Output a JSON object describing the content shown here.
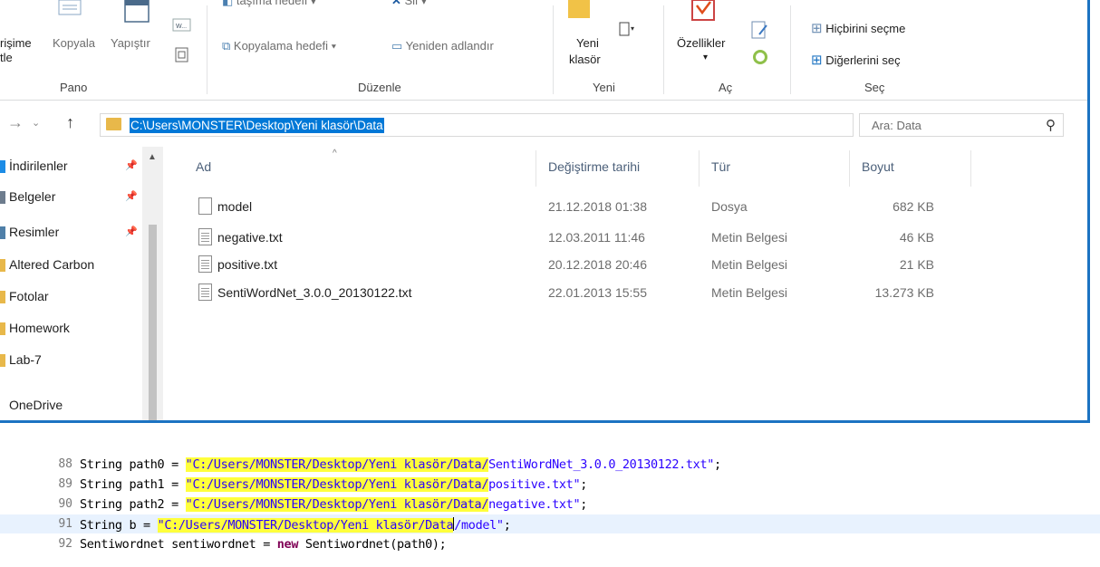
{
  "ribbon": {
    "pano": {
      "label": "Pano",
      "erisime_line1": "rişime",
      "erisime_line2": "tle",
      "copy": "Kopyala",
      "paste": "Yapıştır"
    },
    "duzenle": {
      "label": "Düzenle",
      "move_to": "taşıma hedefi",
      "delete": "Sil",
      "copy_to": "Kopyalama hedefi",
      "rename": "Yeniden adlandır"
    },
    "yeni": {
      "label": "Yeni",
      "new_folder_line1": "Yeni",
      "new_folder_line2": "klasör"
    },
    "ac": {
      "label": "Aç",
      "properties": "Özellikler"
    },
    "sec": {
      "label": "Seç",
      "select_none": "Hiçbirini seçme",
      "invert": "Diğerlerini seç"
    }
  },
  "address": {
    "path": "C:\\Users\\MONSTER\\Desktop\\Yeni klasör\\Data",
    "search_placeholder": "Ara: Data"
  },
  "navpane": {
    "items": [
      {
        "label": "İndirilenler",
        "color": "#1c8ce6"
      },
      {
        "label": "Belgeler",
        "color": "#6d7c8d"
      },
      {
        "label": "Resimler",
        "color": "#4f7fa8"
      },
      {
        "label": "Altered Carbon",
        "color": "#e8b84a"
      },
      {
        "label": "Fotolar",
        "color": "#e8b84a"
      },
      {
        "label": "Homework",
        "color": "#e8b84a"
      },
      {
        "label": "Lab-7",
        "color": "#e8b84a"
      },
      {
        "label": "OneDrive",
        "color": "#ffffff"
      }
    ]
  },
  "filelist": {
    "columns": {
      "name": "Ad",
      "date": "Değiştirme tarihi",
      "type": "Tür",
      "size": "Boyut"
    },
    "rows": [
      {
        "name": "model",
        "date": "21.12.2018 01:38",
        "type": "Dosya",
        "size": "682 KB"
      },
      {
        "name": "negative.txt",
        "date": "12.03.2011 11:46",
        "type": "Metin Belgesi",
        "size": "46 KB"
      },
      {
        "name": "positive.txt",
        "date": "20.12.2018 20:46",
        "type": "Metin Belgesi",
        "size": "21 KB"
      },
      {
        "name": "SentiWordNet_3.0.0_20130122.txt",
        "date": "22.01.2013 15:55",
        "type": "Metin Belgesi",
        "size": "13.273 KB"
      }
    ]
  },
  "code": {
    "lines": [
      {
        "no": "88",
        "pre": "String path0 = ",
        "q": "\"",
        "hl": "C:/Users/MONSTER/Desktop/Yeni klasör/Data/",
        "rest": "SentiWordNet_3.0.0_20130122.txt\"",
        "end": ";"
      },
      {
        "no": "89",
        "pre": "String path1 = ",
        "q": "\"",
        "hl": "C:/Users/MONSTER/Desktop/Yeni klasör/Data/",
        "rest": "positive.txt\"",
        "end": ";"
      },
      {
        "no": "90",
        "pre": "String path2 = ",
        "q": "\"",
        "hl": "C:/Users/MONSTER/Desktop/Yeni klasör/Data/",
        "rest": "negative.txt\"",
        "end": ";"
      },
      {
        "no": "91",
        "pre": "String b = ",
        "q": "\"",
        "hl": "C:/Users/MONSTER/Desktop/Yeni klasör/Data",
        "rest": "/model\"",
        "end": ";"
      },
      {
        "no": "92",
        "pre": "Sentiwordnet sentiwordnet = ",
        "kw": "new",
        "post": " Sentiwordnet(path0);"
      }
    ]
  }
}
